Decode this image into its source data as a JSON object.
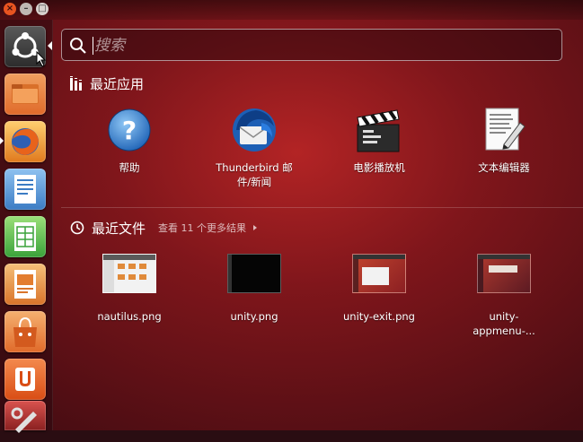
{
  "window_controls": {
    "close_glyph": "×",
    "min_glyph": "–",
    "max_glyph": "□"
  },
  "launcher": {
    "items": [
      {
        "name": "dash-home",
        "icon": "ubuntu-logo-icon"
      },
      {
        "name": "files",
        "icon": "folder-icon"
      },
      {
        "name": "firefox",
        "icon": "firefox-icon"
      },
      {
        "name": "libreoffice-writer",
        "icon": "writer-icon"
      },
      {
        "name": "libreoffice-calc",
        "icon": "calc-icon"
      },
      {
        "name": "libreoffice-impress",
        "icon": "impress-icon"
      },
      {
        "name": "software-center",
        "icon": "shopping-bag-icon"
      },
      {
        "name": "ubuntu-one",
        "icon": "ubuntu-one-icon"
      },
      {
        "name": "system-settings",
        "icon": "settings-icon"
      }
    ]
  },
  "search": {
    "placeholder": "搜索"
  },
  "recent_apps": {
    "title": "最近应用",
    "items": [
      {
        "label": "帮助",
        "icon": "help-icon"
      },
      {
        "label_line1": "Thunderbird 邮",
        "label_line2": "件/新闻",
        "icon": "thunderbird-icon"
      },
      {
        "label": "电影播放机",
        "icon": "clapperboard-icon"
      },
      {
        "label": "文本编辑器",
        "icon": "text-editor-icon"
      }
    ]
  },
  "recent_files": {
    "title": "最近文件",
    "more_results": "查看 11 个更多结果",
    "items": [
      {
        "label": "nautilus.png"
      },
      {
        "label": "unity.png"
      },
      {
        "label": "unity-exit.png"
      },
      {
        "label_line1": "unity-",
        "label_line2": "appmenu-..."
      }
    ]
  },
  "colors": {
    "accent_orange": "#e95420",
    "bg_red": "#b8242c"
  }
}
